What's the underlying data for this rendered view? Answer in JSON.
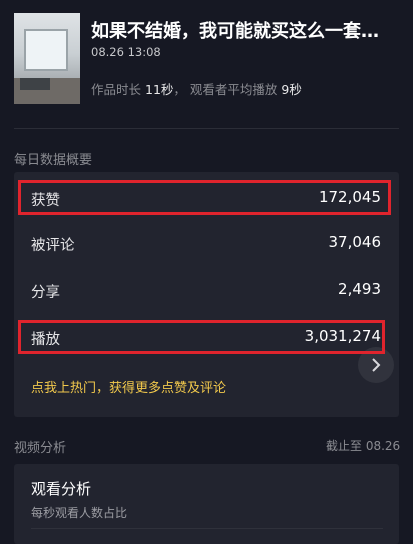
{
  "video": {
    "title": "如果不结婚，我可能就买这么一套…",
    "date": "08.26 13:08",
    "duration_label": "作品时长",
    "duration_value": "11秒",
    "sep": "，",
    "avg_label": "观看者平均播放",
    "avg_value": "9秒"
  },
  "daily": {
    "section_title": "每日数据概要",
    "rows": [
      {
        "label": "获赞",
        "value": "172,045"
      },
      {
        "label": "被评论",
        "value": "37,046"
      },
      {
        "label": "分享",
        "value": "2,493"
      },
      {
        "label": "播放",
        "value": "3,031,274"
      }
    ],
    "promo": "点我上热门，获得更多点赞及评论"
  },
  "analysis": {
    "section_title": "视频分析",
    "cutoff": "截止至 08.26",
    "card_title": "观看分析",
    "card_subtitle": "每秒观看人数占比"
  },
  "colors": {
    "highlight": "#e0242d",
    "promo": "#f2c94c",
    "background": "#161823",
    "card": "#22242f"
  },
  "icons": {
    "arrow": "chevron-right-icon"
  }
}
